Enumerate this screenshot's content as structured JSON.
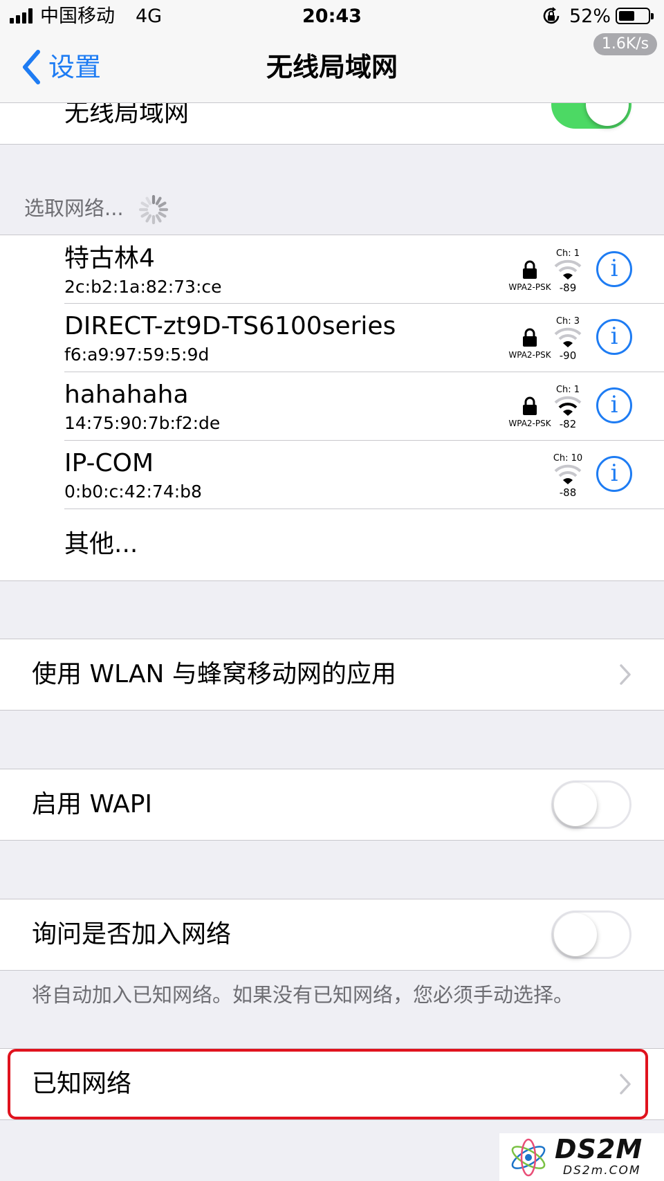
{
  "status_bar": {
    "carrier": "中国移动",
    "network": "4G",
    "time": "20:43",
    "battery": "52%",
    "battery_level": 0.52,
    "speed": "1.6K/s"
  },
  "nav": {
    "back_label": "设置",
    "title": "无线局域网"
  },
  "wlan_row": {
    "label": "无线局域网",
    "enabled": true
  },
  "choose_network": {
    "header": "选取网络...",
    "networks": [
      {
        "name": "特古林4",
        "mac": "2c:b2:1a:82:73:ce",
        "security": "WPA2-PSK",
        "channel": "Ch: 1",
        "rssi": "-89"
      },
      {
        "name": "DIRECT-zt9D-TS6100series",
        "mac": "f6:a9:97:59:5:9d",
        "security": "WPA2-PSK",
        "channel": "Ch: 3",
        "rssi": "-90"
      },
      {
        "name": "hahahaha",
        "mac": "14:75:90:7b:f2:de",
        "security": "WPA2-PSK",
        "channel": "Ch: 1",
        "rssi": "-82"
      },
      {
        "name": "IP-COM",
        "mac": "0:b0:c:42:74:b8",
        "security": "",
        "channel": "Ch: 10",
        "rssi": "-88"
      }
    ],
    "other_label": "其他...",
    "info_glyph": "i"
  },
  "apps_row": {
    "label": "使用 WLAN 与蜂窝移动网的应用"
  },
  "wapi_row": {
    "label": "启用 WAPI",
    "enabled": false
  },
  "ask_join_row": {
    "label": "询问是否加入网络",
    "enabled": false,
    "footer": "将自动加入已知网络。如果没有已知网络，您必须手动选择。"
  },
  "known_networks_row": {
    "label": "已知网络"
  },
  "watermark": {
    "logo": "DS2M",
    "site": "DS2m.COM"
  },
  "colors": {
    "accent": "#1e7cf3",
    "toggle_on": "#4cd964",
    "highlight": "#e0131e",
    "background": "#efeff4"
  }
}
